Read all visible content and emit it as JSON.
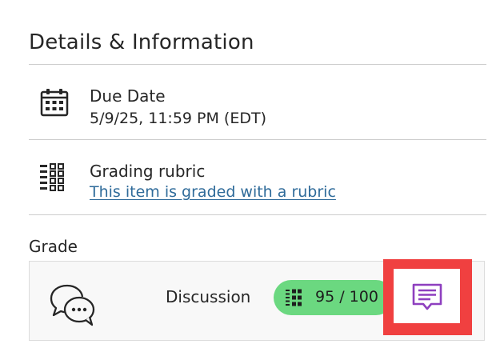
{
  "details": {
    "title": "Details & Information",
    "due_date": {
      "label": "Due Date",
      "value": "5/9/25, 11:59 PM (EDT)",
      "icon": "calendar-icon"
    },
    "rubric": {
      "label": "Grading rubric",
      "link_text": "This item is graded with a rubric",
      "icon": "rubric-grid-icon"
    }
  },
  "grade": {
    "label": "Grade",
    "item": {
      "name": "Discussion",
      "icon": "discussion-bubbles-icon",
      "score": "95 / 100",
      "score_icon": "rubric-grid-icon",
      "pill_color": "#6bd880",
      "feedback_icon": "feedback-comment-icon",
      "feedback_color": "#8e3fbf"
    }
  },
  "colors": {
    "link": "#2f6b9a",
    "highlight": "#f04040",
    "text": "#262626"
  }
}
